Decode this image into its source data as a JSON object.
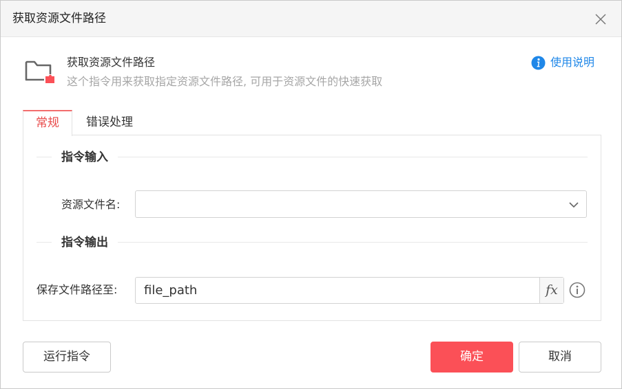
{
  "window": {
    "title": "获取资源文件路径"
  },
  "header": {
    "title": "获取资源文件路径",
    "description": "这个指令用来获取指定资源文件路径, 可用于资源文件的快速获取",
    "help_label": "使用说明",
    "icon": "folder-puzzle-icon"
  },
  "tabs": [
    {
      "label": "常规",
      "active": true
    },
    {
      "label": "错误处理",
      "active": false
    }
  ],
  "sections": {
    "input": {
      "title": "指令输入",
      "resource_label": "资源文件名:",
      "resource_value": ""
    },
    "output": {
      "title": "指令输出",
      "save_label": "保存文件路径至:",
      "save_value": "file_path",
      "fx_label": "fx"
    }
  },
  "footer": {
    "run_label": "运行指令",
    "ok_label": "确定",
    "cancel_label": "取消"
  },
  "colors": {
    "accent": "#fb5057",
    "tab_active": "#e84a4a",
    "link": "#1f87e8",
    "muted_text": "#a6a6a6"
  }
}
